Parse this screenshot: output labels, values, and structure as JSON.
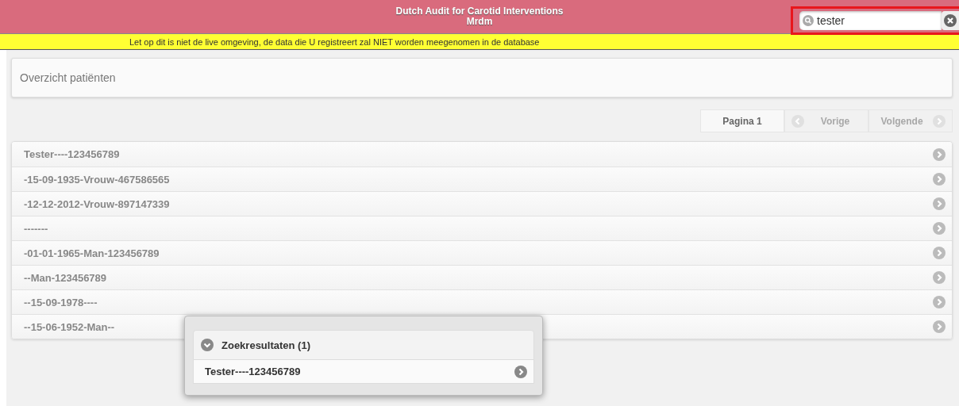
{
  "header": {
    "title": "Dutch Audit for Carotid Interventions",
    "subtitle": "Mrdm"
  },
  "search": {
    "value": "tester"
  },
  "notice": "Let op dit is niet de live omgeving, de data die U registreert zal NIET worden meegenomen in de database",
  "panel_title": "Overzicht patiënten",
  "pagination": [
    {
      "label": "Pagina 1",
      "kind": "page",
      "disabled": false
    },
    {
      "label": "Vorige",
      "kind": "prev",
      "disabled": true
    },
    {
      "label": "Volgende",
      "kind": "next",
      "disabled": true
    }
  ],
  "patients": [
    "Tester----123456789",
    "-15-09-1935-Vrouw-467586565",
    "-12-12-2012-Vrouw-897147339",
    "-------",
    "-01-01-1965-Man-123456789",
    "--Man-123456789",
    "--15-09-1978----",
    "--15-06-1952-Man--"
  ],
  "search_results": {
    "title": "Zoekresultaten (1)",
    "expanded": true,
    "items": [
      "Tester----123456789"
    ]
  }
}
